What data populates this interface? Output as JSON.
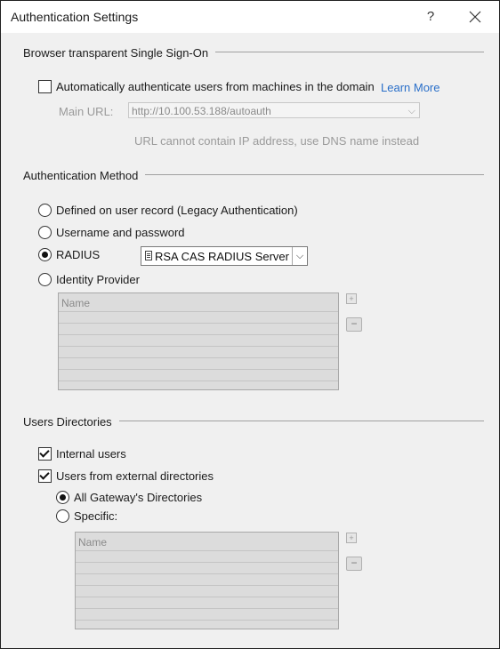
{
  "window": {
    "title": "Authentication Settings",
    "help_glyph": "?",
    "close_glyph": "✕"
  },
  "sso": {
    "section_title": "Browser transparent Single Sign-On",
    "auto_auth_label": "Automatically authenticate users from machines in the domain",
    "auto_auth_checked": false,
    "learn_more": "Learn More",
    "main_url_label": "Main URL:",
    "main_url_value": "http://10.100.53.188/autoauth",
    "warning": "URL cannot contain IP address, use DNS name instead"
  },
  "auth_method": {
    "section_title": "Authentication Method",
    "options": [
      {
        "label": "Defined on user record  (Legacy Authentication)",
        "selected": false
      },
      {
        "label": "Username and password",
        "selected": false
      },
      {
        "label": "RADIUS",
        "selected": true
      },
      {
        "label": "Identity Provider",
        "selected": false
      }
    ],
    "radius_server": "RSA CAS RADIUS Server",
    "idp_table": {
      "header": "Name",
      "add_glyph": "+",
      "remove_glyph": "−"
    }
  },
  "users_directories": {
    "section_title": "Users Directories",
    "internal_users_label": "Internal users",
    "internal_users_checked": true,
    "external_dirs_label": "Users from external directories",
    "external_dirs_checked": true,
    "scope_options": [
      {
        "label": "All Gateway's Directories",
        "selected": true
      },
      {
        "label": "Specific:",
        "selected": false
      }
    ],
    "specific_table": {
      "header": "Name",
      "add_glyph": "+",
      "remove_glyph": "−"
    }
  },
  "colors": {
    "link": "#2a6fc9",
    "dialog_bg": "#f0f0f0",
    "grid_bg": "#dcdcdc"
  }
}
